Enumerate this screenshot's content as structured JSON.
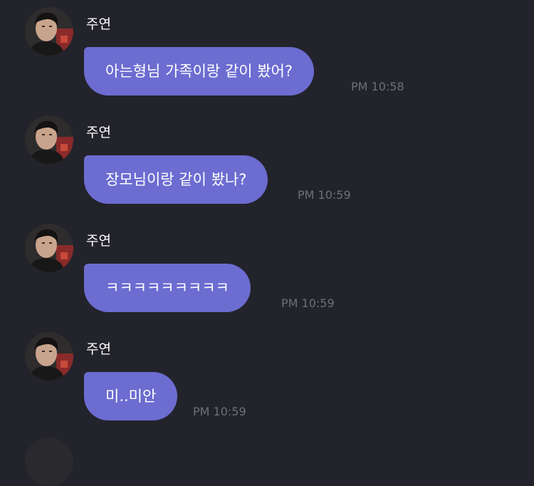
{
  "messages": [
    {
      "sender": "주연",
      "text": "아는형님 가족이랑 같이 봤어?",
      "time": "PM 10:58"
    },
    {
      "sender": "주연",
      "text": "장모님이랑 같이 봤나?",
      "time": "PM 10:59"
    },
    {
      "sender": "주연",
      "text": "ㅋㅋㅋㅋㅋㅋㅋㅋㅋ",
      "time": "PM 10:59"
    },
    {
      "sender": "주연",
      "text": "미..미안",
      "time": "PM 10:59"
    }
  ],
  "colors": {
    "background": "#23232b",
    "bubble": "#6c6cd1",
    "timestamp": "#6f6f78",
    "text": "#ffffff"
  },
  "avatar_icon": "profile-photo"
}
